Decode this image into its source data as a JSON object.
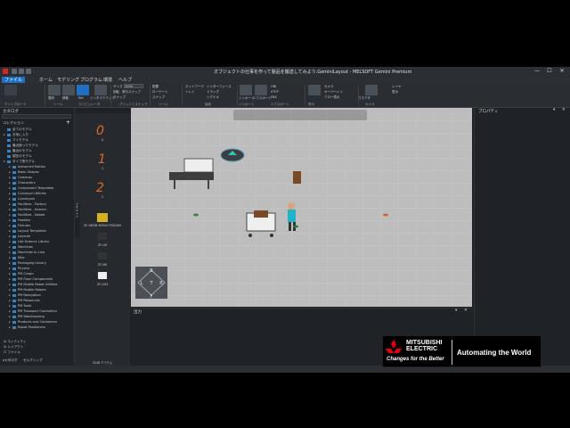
{
  "window": {
    "title": "オブジェクトの仕事を作って製品を搬送してみよう.GeminiLayout - MELSOFT Gemini Premium",
    "minimize": "—",
    "maximize": "☐",
    "close": "✕"
  },
  "menu": [
    "ファイル",
    "ホーム",
    "モデリング",
    "プログラム",
    "環境",
    "ヘルプ"
  ],
  "ribbon": {
    "buttons": [
      "選択",
      "移動",
      "Ref",
      "インタラクティブ"
    ],
    "small_items": [
      "サイズ",
      "回転",
      "スナップ",
      "実行スナップ",
      "配置",
      "ローテート",
      "スナップ",
      "ネットワーク",
      "トレイ",
      "インターフェース",
      "ドラッグ",
      "シグナル",
      "インポート",
      "エクスポート",
      "OBJ",
      "STEP",
      "FBX",
      "スクリーンショット",
      "カメラ",
      "オーバーレイ",
      "フロー表示",
      "コネクタ"
    ],
    "groups": [
      "クリップボード",
      "ツール",
      "マニピュレータ",
      "グリッドとスナップ",
      "ツール",
      "接続",
      "インポート",
      "エクスポート",
      "表示",
      "カメラ",
      "レイヤ",
      "表示"
    ],
    "size_value": "1000"
  },
  "left_panel": {
    "title": "カタログ",
    "section": "コレクション",
    "items": [
      {
        "label": "全てのモデル",
        "arrow": ""
      },
      {
        "label": "お気に入り",
        "arrow": "▸"
      },
      {
        "label": "マイモデル",
        "arrow": ""
      },
      {
        "label": "最近使ったモデル",
        "arrow": ""
      },
      {
        "label": "最近のモデル",
        "arrow": ""
      },
      {
        "label": "現在のモデル",
        "arrow": ""
      },
      {
        "label": "タイプ別モデル",
        "arrow": "▾"
      },
      {
        "label": "Advanced Motion",
        "arrow": "▸"
      },
      {
        "label": "Basic Shapes",
        "arrow": "▸"
      },
      {
        "label": "Cameras",
        "arrow": "▸"
      },
      {
        "label": "Characters",
        "arrow": "▸"
      },
      {
        "label": "Component Templates",
        "arrow": "▸"
      },
      {
        "label": "Conveyor Utilities",
        "arrow": "▸"
      },
      {
        "label": "Conveyors",
        "arrow": "▸"
      },
      {
        "label": "Facilities - Factory",
        "arrow": "▸"
      },
      {
        "label": "Facilities - Interior",
        "arrow": "▸"
      },
      {
        "label": "Facilities - Naked",
        "arrow": "▸"
      },
      {
        "label": "Feeders",
        "arrow": "▸"
      },
      {
        "label": "Fixtures",
        "arrow": "▸"
      },
      {
        "label": "Layout Templates",
        "arrow": "▸"
      },
      {
        "label": "Layouts",
        "arrow": "▸"
      },
      {
        "label": "Life Science Library",
        "arrow": "▸"
      },
      {
        "label": "Machines",
        "arrow": "▸"
      },
      {
        "label": "Machines In-Line",
        "arrow": "▸"
      },
      {
        "label": "Misc",
        "arrow": "▸"
      },
      {
        "label": "Packaging Library",
        "arrow": "▸"
      },
      {
        "label": "Physics",
        "arrow": "▸"
      },
      {
        "label": "PM Crown",
        "arrow": "▸"
      },
      {
        "label": "PM Floor Components",
        "arrow": "▸"
      },
      {
        "label": "PM Mobile Robot Utilities",
        "arrow": "▸"
      },
      {
        "label": "PM Mobile Robots",
        "arrow": "▸"
      },
      {
        "label": "PM Navigation",
        "arrow": "▸"
      },
      {
        "label": "PM Resources",
        "arrow": "▸"
      },
      {
        "label": "PM Tools",
        "arrow": "▸"
      },
      {
        "label": "PM Transport Controllers",
        "arrow": "▸"
      },
      {
        "label": "PM Warehousing",
        "arrow": "▸"
      },
      {
        "label": "Products and Containers",
        "arrow": "▸"
      },
      {
        "label": "Robot Positioners",
        "arrow": "▸"
      }
    ],
    "footer": [
      "エンティティ",
      "レイアウト",
      "ファイル"
    ],
    "tabs": [
      "eカタログ",
      "セルグリップ"
    ]
  },
  "mid_panel": {
    "vertical_tab": "ジオメトリ",
    "thumbs": [
      "0",
      "1",
      "2",
      "ZF-SMOB SERVO PODIUM",
      "ZF-LM",
      "ZF-M0",
      "ZF-LM4"
    ],
    "count": "3248 アイテム"
  },
  "viewport": {
    "compass_labels": [
      "B",
      "L",
      "T",
      "R",
      "F"
    ]
  },
  "bottom_panel": {
    "title": "出力"
  },
  "right_panel": {
    "title": "プロパティ"
  },
  "banner": {
    "brand_line1": "MITSUBISHI",
    "brand_line2": "ELECTRIC",
    "tagline": "Changes for the Better",
    "slogan": "Automating the World"
  },
  "colors": {
    "accent": "#1f70c1",
    "brand_red": "#e60012",
    "background": "#1f2327",
    "floor": "#bdbdbd"
  }
}
